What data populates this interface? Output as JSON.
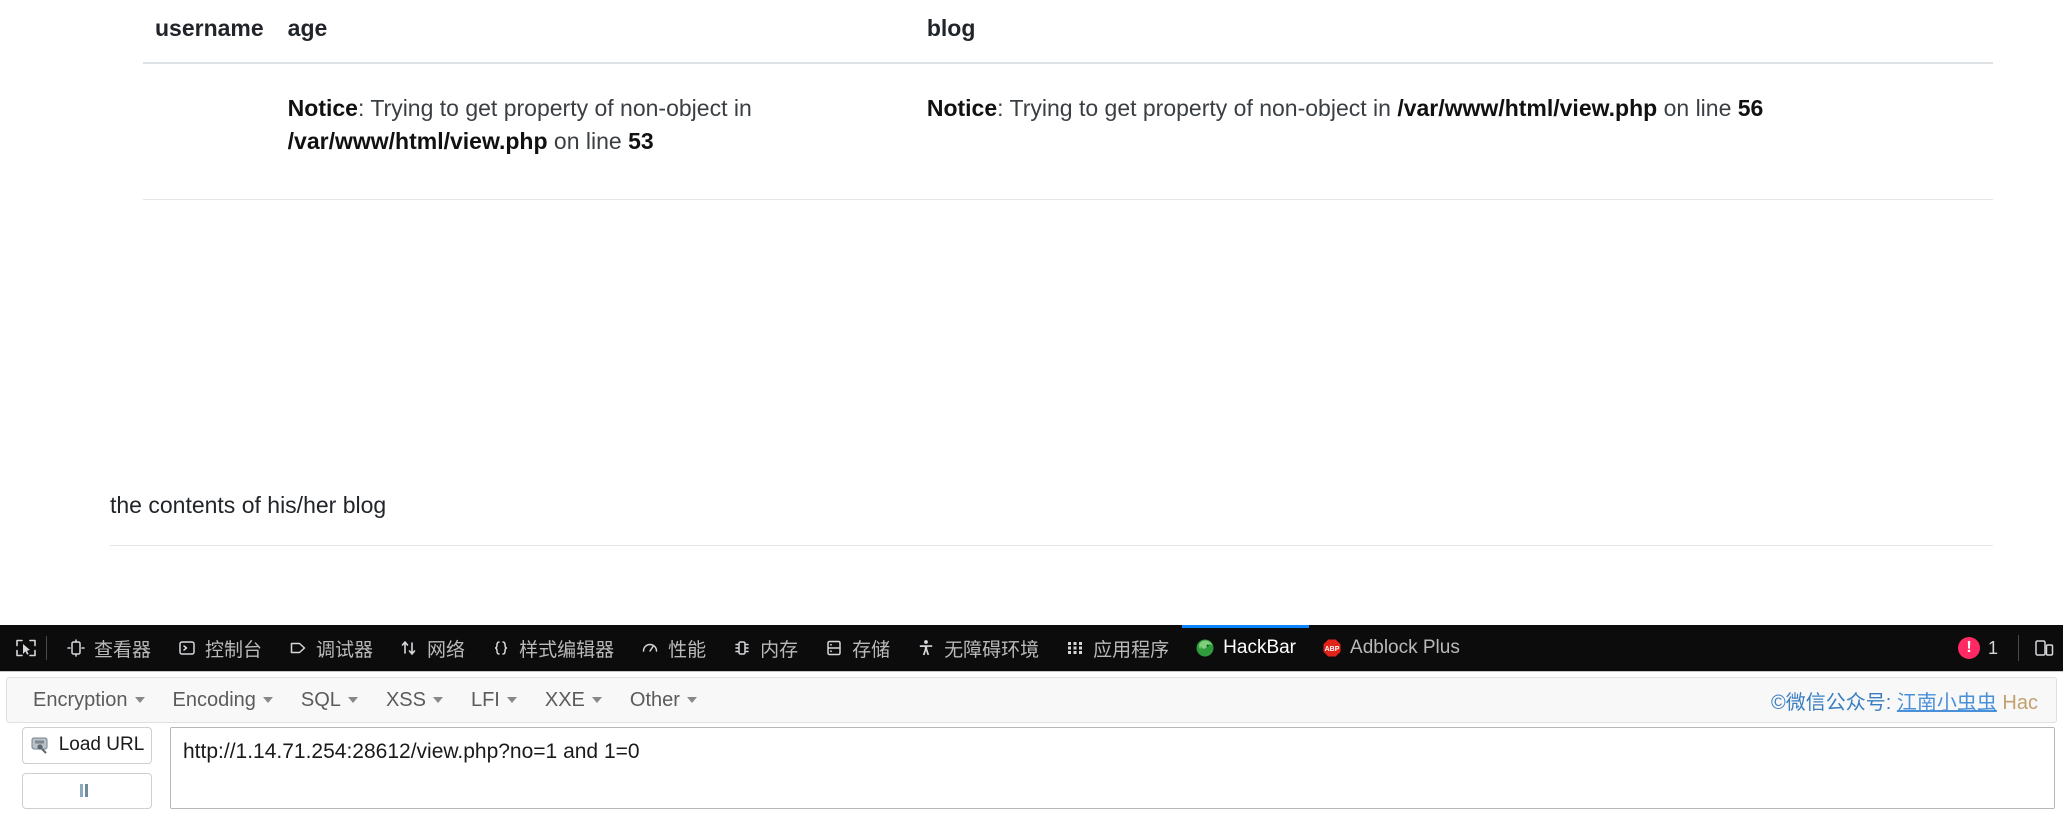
{
  "page": {
    "table": {
      "headers": [
        "username",
        "age",
        "blog"
      ],
      "rows": [
        {
          "username": "",
          "age": {
            "label": "Notice",
            "sep": ": ",
            "text1": "Trying to get property of non-object in ",
            "path": "/var/www/html/view.php",
            "text2": " on line ",
            "line": "53"
          },
          "blog": {
            "label": "Notice",
            "sep": ": ",
            "text1": "Trying to get property of non-object in ",
            "path": "/var/www/html/view.php",
            "text2": " on line ",
            "line": "56"
          }
        }
      ]
    },
    "blog_contents": "the contents of his/her blog"
  },
  "devtools": {
    "picker_icon": "element-picker-icon",
    "tabs": [
      {
        "label": "查看器",
        "icon": "inspector-icon",
        "active": false
      },
      {
        "label": "控制台",
        "icon": "console-icon",
        "active": false
      },
      {
        "label": "调试器",
        "icon": "debugger-icon",
        "active": false
      },
      {
        "label": "网络",
        "icon": "network-icon",
        "active": false
      },
      {
        "label": "样式编辑器",
        "icon": "style-editor-icon",
        "active": false
      },
      {
        "label": "性能",
        "icon": "performance-icon",
        "active": false
      },
      {
        "label": "内存",
        "icon": "memory-icon",
        "active": false
      },
      {
        "label": "存储",
        "icon": "storage-icon",
        "active": false
      },
      {
        "label": "无障碍环境",
        "icon": "accessibility-icon",
        "active": false
      },
      {
        "label": "应用程序",
        "icon": "application-icon",
        "active": false
      },
      {
        "label": "HackBar",
        "icon": "hackbar-firefox-icon",
        "active": true
      },
      {
        "label": "Adblock Plus",
        "icon": "adblock-plus-icon",
        "active": false
      }
    ],
    "error_badge": {
      "symbol": "!",
      "count": "1"
    },
    "responsive_mode_icon": "responsive-design-mode-icon",
    "accent_active": "#0a84ff",
    "error_color": "#ff2a63"
  },
  "hackbar": {
    "menus": [
      {
        "label": "Encryption"
      },
      {
        "label": "Encoding"
      },
      {
        "label": "SQL"
      },
      {
        "label": "XSS"
      },
      {
        "label": "LFI"
      },
      {
        "label": "XXE"
      },
      {
        "label": "Other"
      }
    ],
    "credit": {
      "prefix": "©微信公众号: ",
      "link": "江南小虫虫",
      "suffix": " Hac"
    },
    "load_url_button": "Load URL",
    "split_url_button": "",
    "url_value": "http://1.14.71.254:28612/view.php?no=1 and 1=0",
    "url_placeholder": ""
  }
}
